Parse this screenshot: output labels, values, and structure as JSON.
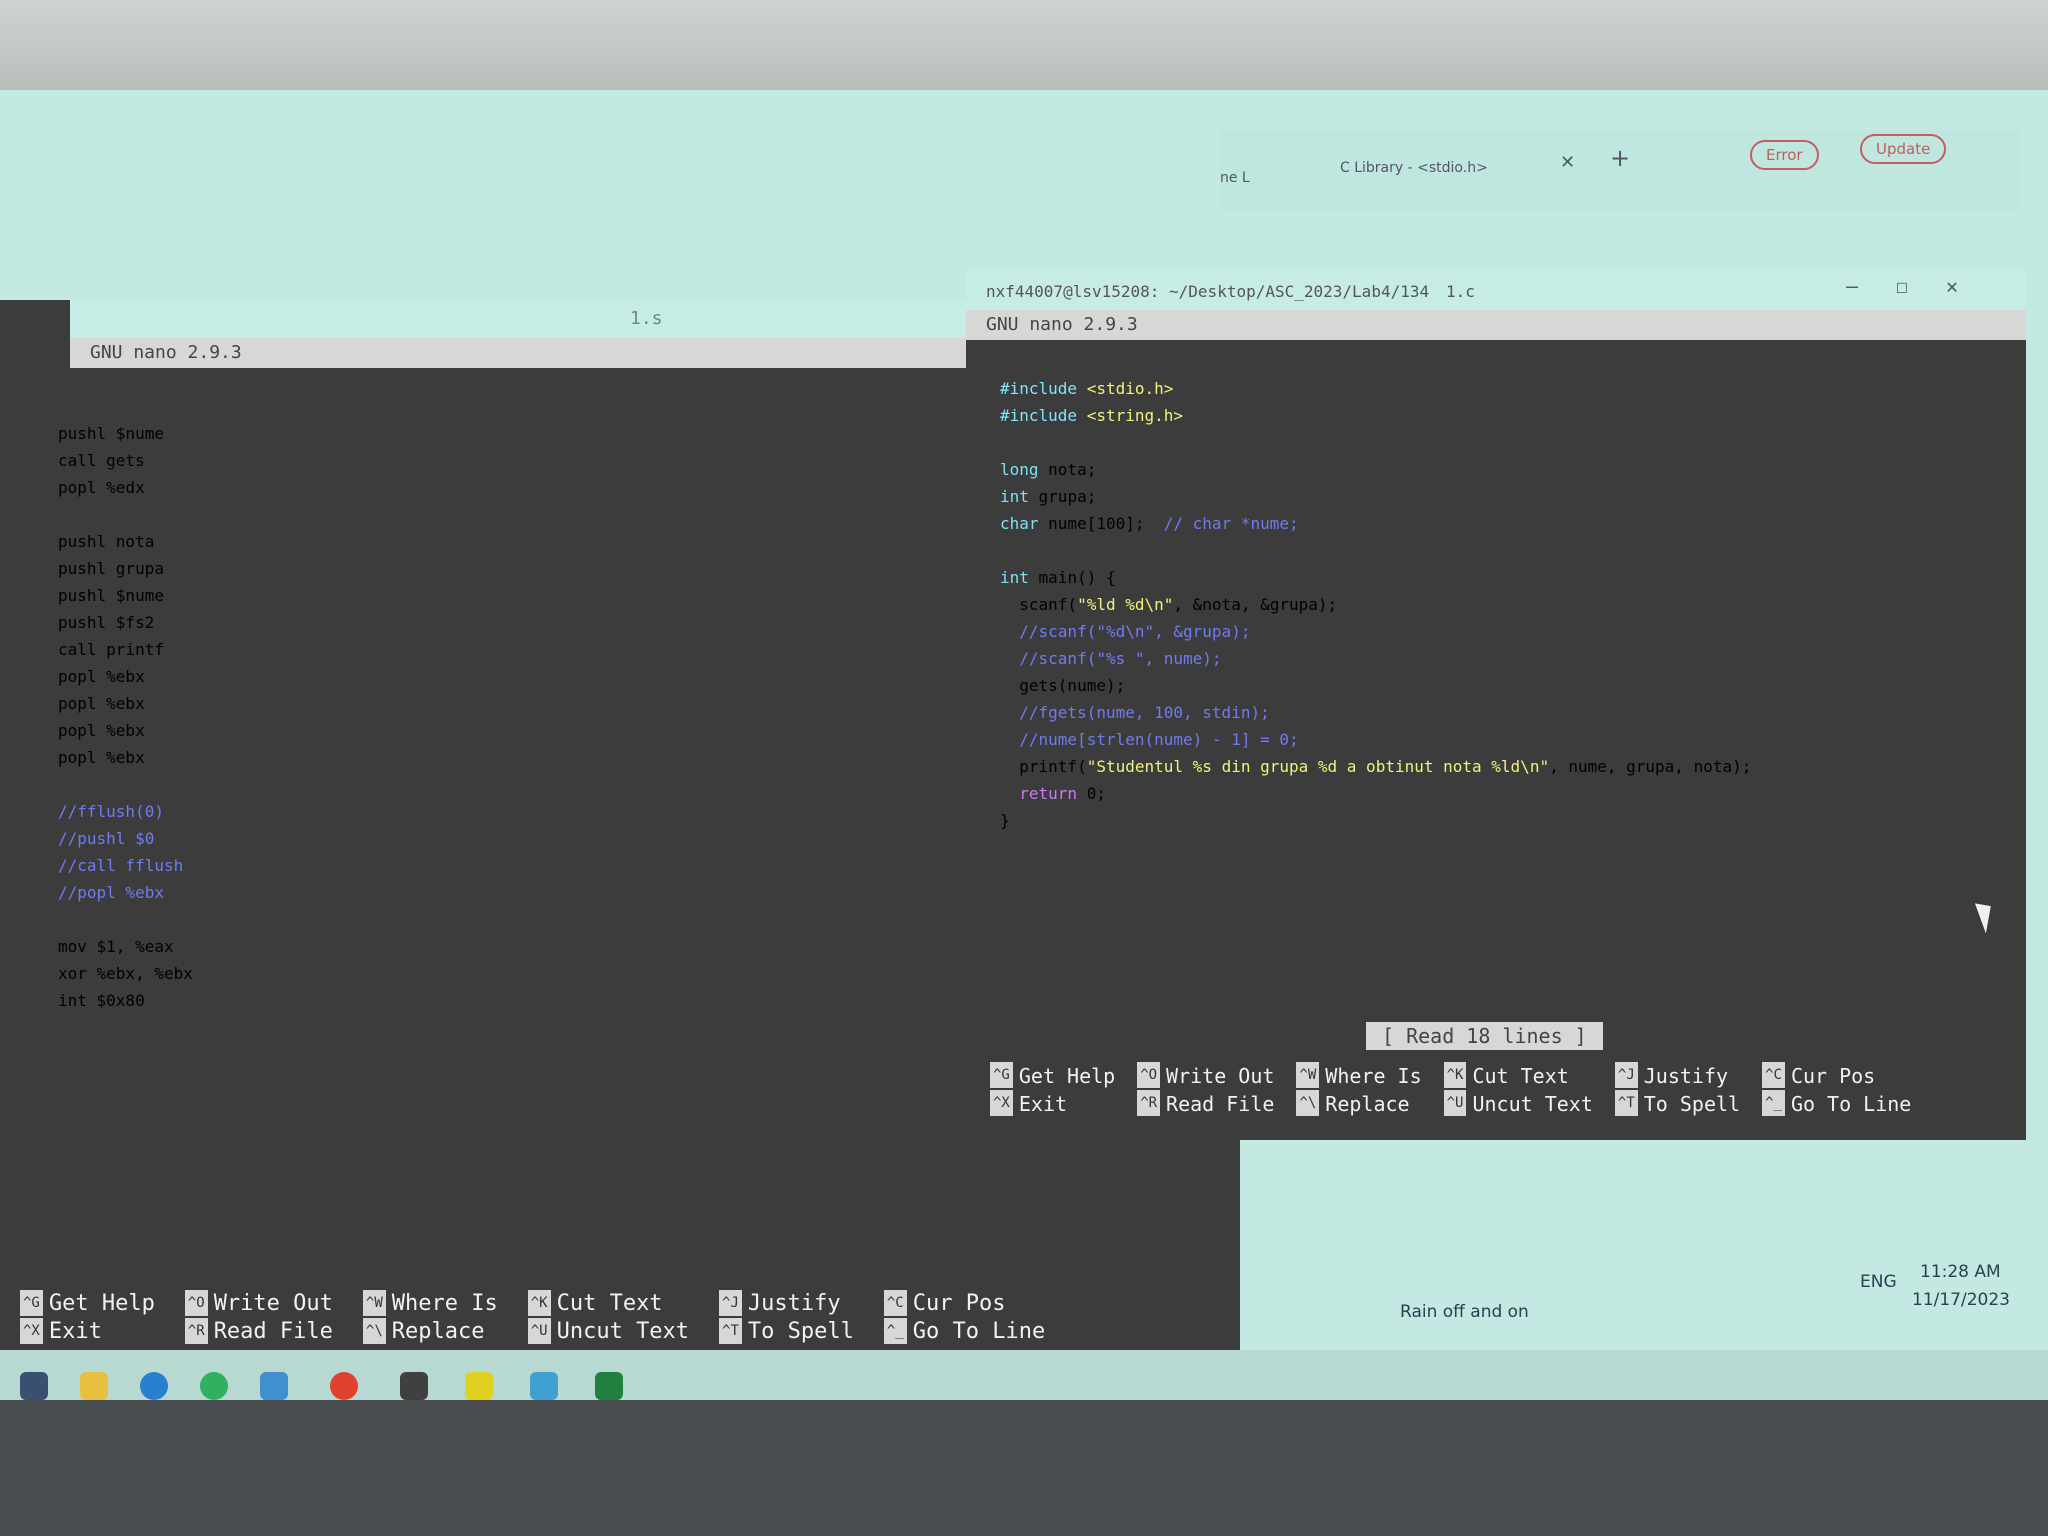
{
  "browser": {
    "tab_label_partial": "ne L",
    "tab_label": "C Library - <stdio.h>",
    "error_label": "Error",
    "update_label": "Update"
  },
  "left_window": {
    "title_file": "1.s",
    "nano_header": "GNU nano 2.9.3",
    "code_lines": [
      {
        "text": "pushl $nume",
        "type": "code"
      },
      {
        "text": "call gets",
        "type": "code"
      },
      {
        "text": "popl %edx",
        "type": "code"
      },
      {
        "text": "",
        "type": "code"
      },
      {
        "text": "pushl nota",
        "type": "code"
      },
      {
        "text": "pushl grupa",
        "type": "code"
      },
      {
        "text": "pushl $nume",
        "type": "code"
      },
      {
        "text": "pushl $fs2",
        "type": "code"
      },
      {
        "text": "call printf",
        "type": "code"
      },
      {
        "text": "popl %ebx",
        "type": "code"
      },
      {
        "text": "popl %ebx",
        "type": "code"
      },
      {
        "text": "popl %ebx",
        "type": "code"
      },
      {
        "text": "popl %ebx",
        "type": "code"
      },
      {
        "text": "",
        "type": "code"
      },
      {
        "text": "//fflush(0)",
        "type": "comment"
      },
      {
        "text": "//pushl $0",
        "type": "comment"
      },
      {
        "text": "//call fflush",
        "type": "comment"
      },
      {
        "text": "//popl %ebx",
        "type": "comment"
      },
      {
        "text": "",
        "type": "code"
      },
      {
        "text": "mov $1, %eax",
        "type": "code"
      },
      {
        "text": "xor %ebx, %ebx",
        "type": "code"
      },
      {
        "text": "int $0x80",
        "type": "code"
      }
    ],
    "shortcuts": [
      {
        "k1": "^G",
        "l1": "Get Help",
        "k2": "^X",
        "l2": "Exit"
      },
      {
        "k1": "^O",
        "l1": "Write Out",
        "k2": "^R",
        "l2": "Read File"
      },
      {
        "k1": "^W",
        "l1": "Where Is",
        "k2": "^\\",
        "l2": "Replace"
      },
      {
        "k1": "^K",
        "l1": "Cut Text",
        "k2": "^U",
        "l2": "Uncut Text"
      },
      {
        "k1": "^J",
        "l1": "Justify",
        "k2": "^T",
        "l2": "To Spell"
      },
      {
        "k1": "^C",
        "l1": "Cur Pos",
        "k2": "^_",
        "l2": "Go To Line"
      }
    ]
  },
  "right_window": {
    "title_path": "nxf44007@lsv15208: ~/Desktop/ASC_2023/Lab4/134",
    "title_file": "1.c",
    "nano_header": "GNU nano 2.9.3",
    "status_message": "[ Read 18 lines ]",
    "code_lines": [
      {
        "segments": [
          {
            "t": "#include ",
            "c": "inc"
          },
          {
            "t": "<stdio.h>",
            "c": "hdr"
          }
        ]
      },
      {
        "segments": [
          {
            "t": "#include ",
            "c": "inc"
          },
          {
            "t": "<string.h>",
            "c": "hdr"
          }
        ]
      },
      {
        "segments": [
          {
            "t": "",
            "c": ""
          }
        ]
      },
      {
        "segments": [
          {
            "t": "long",
            "c": "kw"
          },
          {
            "t": " nota;",
            "c": ""
          }
        ]
      },
      {
        "segments": [
          {
            "t": "int",
            "c": "kw"
          },
          {
            "t": " grupa;",
            "c": ""
          }
        ]
      },
      {
        "segments": [
          {
            "t": "char",
            "c": "kw"
          },
          {
            "t": " nume[100];  ",
            "c": ""
          },
          {
            "t": "// char *nume;",
            "c": "cmt"
          }
        ]
      },
      {
        "segments": [
          {
            "t": "",
            "c": ""
          }
        ]
      },
      {
        "segments": [
          {
            "t": "int",
            "c": "kw"
          },
          {
            "t": " main() {",
            "c": ""
          }
        ]
      },
      {
        "segments": [
          {
            "t": "  scanf(",
            "c": ""
          },
          {
            "t": "\"%ld %d\\n\"",
            "c": "str"
          },
          {
            "t": ", &nota, &grupa);",
            "c": ""
          }
        ]
      },
      {
        "segments": [
          {
            "t": "  //scanf(\"%d\\n\", &grupa);",
            "c": "cmt"
          }
        ]
      },
      {
        "segments": [
          {
            "t": "  //scanf(\"%s \", nume);",
            "c": "cmt"
          }
        ]
      },
      {
        "segments": [
          {
            "t": "  gets(nume);",
            "c": ""
          }
        ]
      },
      {
        "segments": [
          {
            "t": "  //fgets(nume, 100, stdin);",
            "c": "cmt"
          }
        ]
      },
      {
        "segments": [
          {
            "t": "  //nume[strlen(nume) - 1] = 0;",
            "c": "cmt"
          }
        ]
      },
      {
        "segments": [
          {
            "t": "  printf(",
            "c": ""
          },
          {
            "t": "\"Studentul %s din grupa %d a obtinut nota %ld\\n\"",
            "c": "str"
          },
          {
            "t": ", nume, grupa, nota);",
            "c": ""
          }
        ]
      },
      {
        "segments": [
          {
            "t": "  return",
            "c": "ret"
          },
          {
            "t": " 0;",
            "c": ""
          }
        ]
      },
      {
        "segments": [
          {
            "t": "}",
            "c": ""
          }
        ]
      }
    ],
    "shortcuts": [
      {
        "k1": "^G",
        "l1": "Get Help",
        "k2": "^X",
        "l2": "Exit"
      },
      {
        "k1": "^O",
        "l1": "Write Out",
        "k2": "^R",
        "l2": "Read File"
      },
      {
        "k1": "^W",
        "l1": "Where Is",
        "k2": "^\\",
        "l2": "Replace"
      },
      {
        "k1": "^K",
        "l1": "Cut Text",
        "k2": "^U",
        "l2": "Uncut Text"
      },
      {
        "k1": "^J",
        "l1": "Justify",
        "k2": "^T",
        "l2": "To Spell"
      },
      {
        "k1": "^C",
        "l1": "Cur Pos",
        "k2": "^_",
        "l2": "Go To Line"
      }
    ]
  },
  "taskbar": {
    "weather": "Rain off and on",
    "language": "ENG",
    "time": "11:28 AM",
    "date": "11/17/2023"
  }
}
